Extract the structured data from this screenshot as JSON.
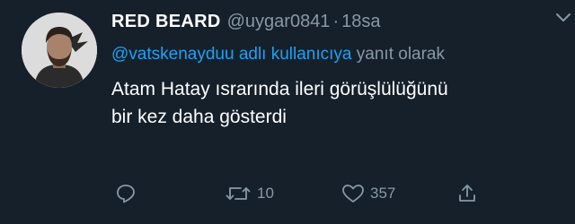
{
  "tweet": {
    "display_name": "RED BEARD",
    "handle": "@uygar0841",
    "separator": "·",
    "time": "18sa",
    "reply_mention": "@vatskenayduu adlı kullanıcıya",
    "reply_suffix": "yanıt olarak",
    "text_line1": "Atam Hatay ısrarında ileri görüşlülüğünü",
    "text_line2": "bir kez daha gösterdi"
  },
  "actions": {
    "reply_icon": "reply-icon",
    "retweet_icon": "retweet-icon",
    "retweet_count": "10",
    "like_icon": "heart-icon",
    "like_count": "357",
    "share_icon": "share-icon"
  },
  "colors": {
    "background": "#15202b",
    "primary_text": "#ffffff",
    "secondary_text": "#8899a6",
    "accent": "#1da1f2"
  }
}
